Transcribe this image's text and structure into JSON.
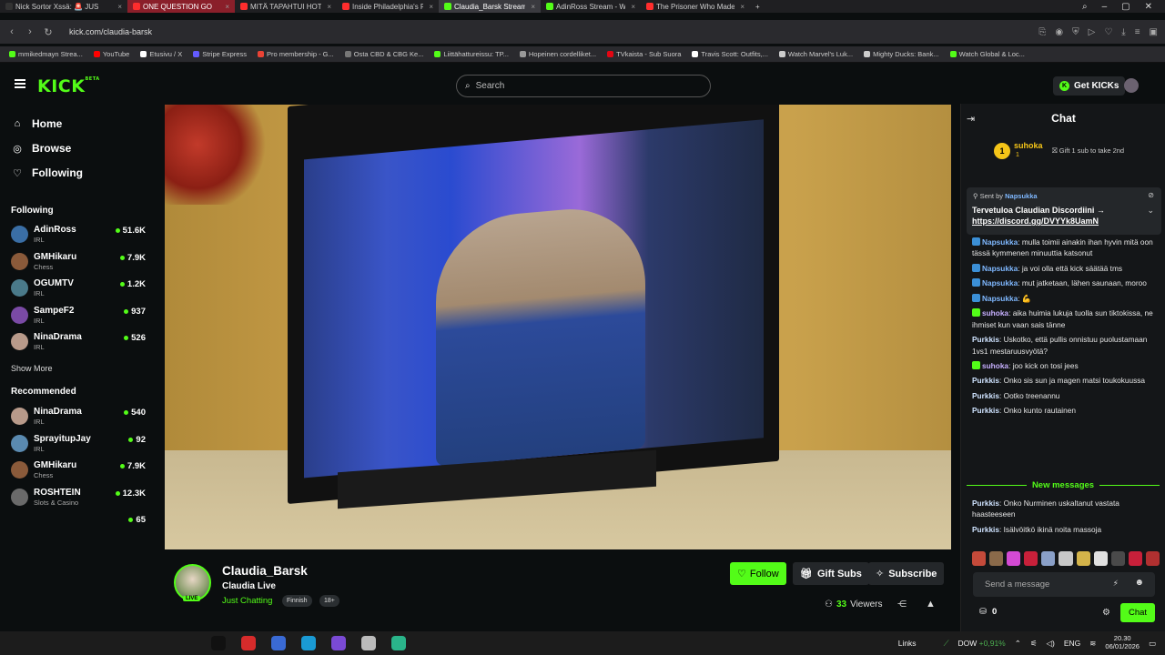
{
  "browser": {
    "tabs": [
      {
        "label": "Nick Sortor Xssä: 🚨 JUS",
        "color": "#333333",
        "state": "normal"
      },
      {
        "label": "ONE QUESTION GO",
        "color": "#ff2d2d",
        "state": "highlight"
      },
      {
        "label": "MITÄ TAPAHTUI HOTELLI",
        "color": "#ff2d2d",
        "state": "normal"
      },
      {
        "label": "Inside Philadelphia's Real",
        "color": "#ff2d2d",
        "state": "normal"
      },
      {
        "label": "Claudia_Barsk Stream",
        "color": "#53fc18",
        "state": "active"
      },
      {
        "label": "AdinRoss Stream - Watch",
        "color": "#53fc18",
        "state": "normal"
      },
      {
        "label": "The Prisoner Who Made t",
        "color": "#ff2d2d",
        "state": "normal"
      }
    ],
    "url": "kick.com/claudia-barsk",
    "bookmarks": [
      {
        "label": "mmikedmayn Strea...",
        "color": "#53fc18"
      },
      {
        "label": "YouTube",
        "color": "#ff0000"
      },
      {
        "label": "Etusivu / X",
        "color": "#ffffff"
      },
      {
        "label": "Stripe Express",
        "color": "#635bff"
      },
      {
        "label": "Pro membership - G...",
        "color": "#ea4335"
      },
      {
        "label": "Osta CBD & CBG Ke...",
        "color": "#777777"
      },
      {
        "label": "Liittähattureissu: TP...",
        "color": "#53fc18"
      },
      {
        "label": "Hopeinen cordelliket...",
        "color": "#999999"
      },
      {
        "label": "TVkaista - Sub Suora",
        "color": "#e30613"
      },
      {
        "label": "Travis Scott: Outfits,...",
        "color": "#ffffff"
      },
      {
        "label": "Watch Marvel's Luk...",
        "color": "#cccccc"
      },
      {
        "label": "Mighty Ducks: Bank...",
        "color": "#cccccc"
      },
      {
        "label": "Watch Global & Loc...",
        "color": "#53fc18"
      }
    ]
  },
  "header": {
    "logo": "KICK",
    "logo_sup": "BETA",
    "search_placeholder": "Search",
    "get_kicks": "Get KICKs"
  },
  "sidebar": {
    "nav": [
      {
        "label": "Home",
        "icon": "home-icon",
        "glyph": "⌂"
      },
      {
        "label": "Browse",
        "icon": "compass-icon",
        "glyph": "◎"
      },
      {
        "label": "Following",
        "icon": "heart-icon",
        "glyph": "♡"
      }
    ],
    "following_title": "Following",
    "following": [
      {
        "name": "AdinRoss",
        "category": "IRL",
        "viewers": "51.6K",
        "color": "#3a6ea5"
      },
      {
        "name": "GMHikaru",
        "category": "Chess",
        "viewers": "7.9K",
        "color": "#8a5a3a"
      },
      {
        "name": "OGUMTV",
        "category": "IRL",
        "viewers": "1.2K",
        "color": "#4a7a8a"
      },
      {
        "name": "SampeF2",
        "category": "IRL",
        "viewers": "937",
        "color": "#7a4aa5"
      },
      {
        "name": "NinaDrama",
        "category": "IRL",
        "viewers": "526",
        "color": "#b89a8a"
      }
    ],
    "show_more": "Show More",
    "recommended_title": "Recommended",
    "recommended": [
      {
        "name": "NinaDrama",
        "category": "IRL",
        "viewers": "540",
        "color": "#b89a8a"
      },
      {
        "name": "SprayitupJay",
        "category": "IRL",
        "viewers": "92",
        "color": "#5a8ab0"
      },
      {
        "name": "GMHikaru",
        "category": "Chess",
        "viewers": "7.9K",
        "color": "#8a5a3a"
      },
      {
        "name": "ROSHTEIN",
        "category": "Slots & Casino",
        "viewers": "12.3K",
        "color": "#6a6a6a"
      },
      {
        "name": "",
        "category": "",
        "viewers": "65",
        "color": "transparent"
      }
    ]
  },
  "stream": {
    "streamer": "Claudia_Barsk",
    "live_badge": "LIVE",
    "title": "Claudia Live",
    "category": "Just Chatting",
    "tags": [
      "Finnish",
      "18+"
    ],
    "follow": "Follow",
    "gift_subs": "Gift Subs",
    "subscribe": "Subscribe",
    "viewers_count": "33",
    "viewers_label": "Viewers"
  },
  "chat": {
    "title": "Chat",
    "gifter": {
      "rank": "1",
      "name": "suhoka",
      "count": "1",
      "text": "Gift 1 sub to take 2nd"
    },
    "pinned": {
      "sent_by": "Sent by",
      "sender": "Napsukka",
      "message": "Tervetuloa Claudian Discordiini →",
      "link": "https://discord.gg/DVYYk8UamN"
    },
    "messages": [
      {
        "user": "Napsukka",
        "color": "#7fb8ff",
        "badge": "#3b8fd6",
        "text": "mulla toimii ainakin ihan hyvin mitä oon tässä kymmenen minuuttia katsonut"
      },
      {
        "user": "Napsukka",
        "color": "#7fb8ff",
        "badge": "#3b8fd6",
        "text": "ja voi olla että kick säätää tms"
      },
      {
        "user": "Napsukka",
        "color": "#7fb8ff",
        "badge": "#3b8fd6",
        "text": "mut jatketaan, lähen saunaan, moroo"
      },
      {
        "user": "Napsukka",
        "color": "#7fb8ff",
        "badge": "#3b8fd6",
        "text": "💪"
      },
      {
        "user": "suhoka",
        "color": "#c7b0ff",
        "badge": "#53fc18",
        "text": "aika huimia lukuja tuolla sun tiktokissa, ne ihmiset kun vaan sais tänne"
      },
      {
        "user": "Purkkis",
        "color": "#cfe3ff",
        "badge": "",
        "text": "Uskotko, että pullis onnistuu puolustamaan 1vs1 mestaruusvyötä?"
      },
      {
        "user": "suhoka",
        "color": "#c7b0ff",
        "badge": "#53fc18",
        "text": "joo kick on tosi jees"
      },
      {
        "user": "Purkkis",
        "color": "#cfe3ff",
        "badge": "",
        "text": "Onko sis sun ja magen matsi toukokuussa"
      },
      {
        "user": "Purkkis",
        "color": "#cfe3ff",
        "badge": "",
        "text": "Ootko treenannu"
      },
      {
        "user": "Purkkis",
        "color": "#cfe3ff",
        "badge": "",
        "text": "Onko kunto rautainen"
      }
    ],
    "new_messages": "New messages",
    "messages_after": [
      {
        "user": "Purkkis",
        "color": "#cfe3ff",
        "text": "Onko Nurminen uskaltanut vastata haasteeseen"
      },
      {
        "user": "Purkkis",
        "color": "#cfe3ff",
        "text": "Isälvöitkö ikinä noita massoja"
      }
    ],
    "emote_colors": [
      "#c44a3a",
      "#8a6a4a",
      "#d44ad4",
      "#c8203a",
      "#8aa0c8",
      "#c8c8c8",
      "#d4b44a",
      "#e0e0e0",
      "#4a4a4a",
      "#c8203a",
      "#b03030"
    ],
    "input_placeholder": "Send a message",
    "points": "0",
    "send": "Chat"
  },
  "taskbar": {
    "apps": [
      "#111111",
      "#d62b2b",
      "#3a6ad4",
      "#1a9ad4",
      "#7a4ad4",
      "#bbbbbb",
      "#2ab48a"
    ],
    "links": "Links",
    "market": "DOW",
    "market_change": "+0,91%",
    "lang": "ENG",
    "time": "20.30",
    "date": "06/01/2026"
  }
}
